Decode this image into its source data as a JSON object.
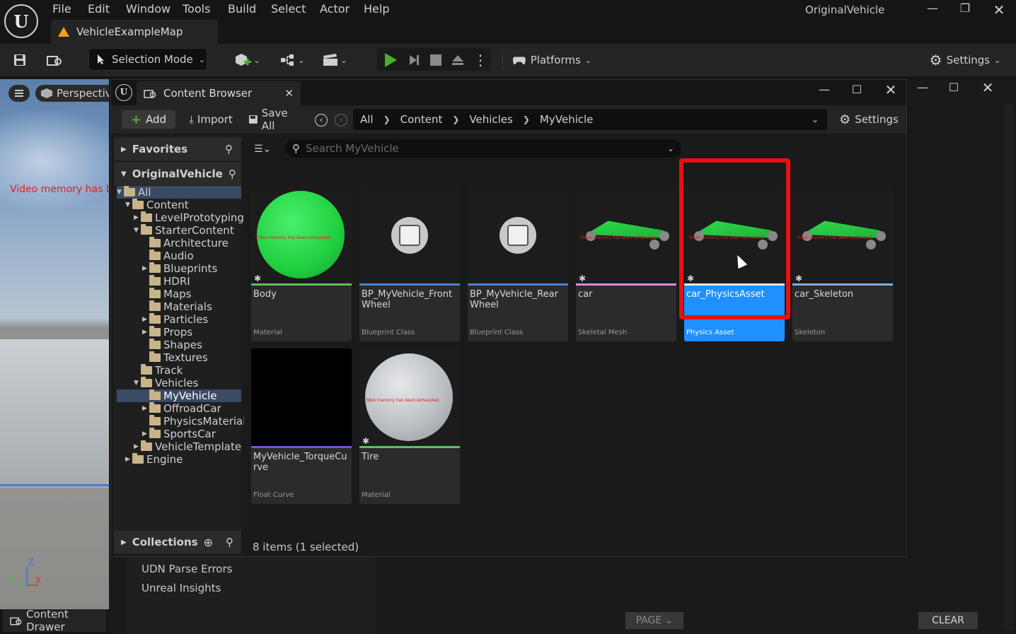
{
  "menu": [
    "File",
    "Edit",
    "Window",
    "Tools",
    "Build",
    "Select",
    "Actor",
    "Help"
  ],
  "window_title": "OriginalVehicle",
  "map_tab": "VehicleExampleMap",
  "toolbar": {
    "selection_mode": "Selection Mode",
    "platforms": "Platforms",
    "settings": "Settings"
  },
  "viewport": {
    "perspective": "Perspective",
    "warning": "Video memory has been exhausted",
    "axis_x": "X",
    "axis_y": "Y",
    "axis_z": "Z"
  },
  "content_drawer": "Content Drawer",
  "content_browser": {
    "tab_title": "Content Browser",
    "add": "Add",
    "import": "Import",
    "save_all": "Save All",
    "breadcrumb": [
      "All",
      "Content",
      "Vehicles",
      "MyVehicle"
    ],
    "settings": "Settings",
    "search_placeholder": "Search MyVehicle",
    "favorites": "Favorites",
    "project": "OriginalVehicle",
    "collections": "Collections",
    "status": "8 items (1 selected)",
    "tree": [
      {
        "label": "All",
        "depth": 0,
        "expanded": true
      },
      {
        "label": "Content",
        "depth": 1,
        "expanded": true
      },
      {
        "label": "LevelPrototyping",
        "depth": 2,
        "expanded": false
      },
      {
        "label": "StarterContent",
        "depth": 2,
        "expanded": true
      },
      {
        "label": "Architecture",
        "depth": 3
      },
      {
        "label": "Audio",
        "depth": 3
      },
      {
        "label": "Blueprints",
        "depth": 3,
        "expanded": false
      },
      {
        "label": "HDRI",
        "depth": 3
      },
      {
        "label": "Maps",
        "depth": 3
      },
      {
        "label": "Materials",
        "depth": 3
      },
      {
        "label": "Particles",
        "depth": 3,
        "expanded": false
      },
      {
        "label": "Props",
        "depth": 3,
        "expanded": false
      },
      {
        "label": "Shapes",
        "depth": 3
      },
      {
        "label": "Textures",
        "depth": 3
      },
      {
        "label": "Track",
        "depth": 2
      },
      {
        "label": "Vehicles",
        "depth": 2,
        "expanded": true
      },
      {
        "label": "MyVehicle",
        "depth": 3,
        "selected": true
      },
      {
        "label": "OffroadCar",
        "depth": 3,
        "expanded": false
      },
      {
        "label": "PhysicsMaterials",
        "depth": 3
      },
      {
        "label": "SportsCar",
        "depth": 3,
        "expanded": false
      },
      {
        "label": "VehicleTemplate",
        "depth": 2,
        "expanded": false
      },
      {
        "label": "Engine",
        "depth": 1,
        "expanded": false
      }
    ],
    "assets": [
      {
        "name": "Body",
        "type": "Material",
        "bar_color": "#5fbf5f"
      },
      {
        "name": "BP_MyVehicle_FrontWheel",
        "type": "Blueprint Class",
        "bar_color": "#4f7fd8"
      },
      {
        "name": "BP_MyVehicle_RearWheel",
        "type": "Blueprint Class",
        "bar_color": "#4f7fd8"
      },
      {
        "name": "car",
        "type": "Skeletal Mesh",
        "bar_color": "#d88ad8"
      },
      {
        "name": "car_PhysicsAsset",
        "type": "Physics Asset",
        "bar_color": "#e8e8e8",
        "selected": true
      },
      {
        "name": "car_Skeleton",
        "type": "Skeleton",
        "bar_color": "#7fb0d8"
      },
      {
        "name": "MyVehicle_TorqueCurve",
        "type": "Float Curve",
        "bar_color": "#7a4fd8"
      },
      {
        "name": "Tire",
        "type": "Material",
        "bar_color": "#5fbf5f"
      }
    ],
    "thumb_warning": "Video memory has been exhausted"
  },
  "bottom": {
    "items": [
      "UDN Parse Errors",
      "Unreal Insights"
    ],
    "page": "PAGE",
    "clear": "CLEAR"
  },
  "colors": {
    "selection_highlight": "#1e90ff",
    "selection_frame": "#e81010",
    "play_green": "#4caf2e"
  }
}
